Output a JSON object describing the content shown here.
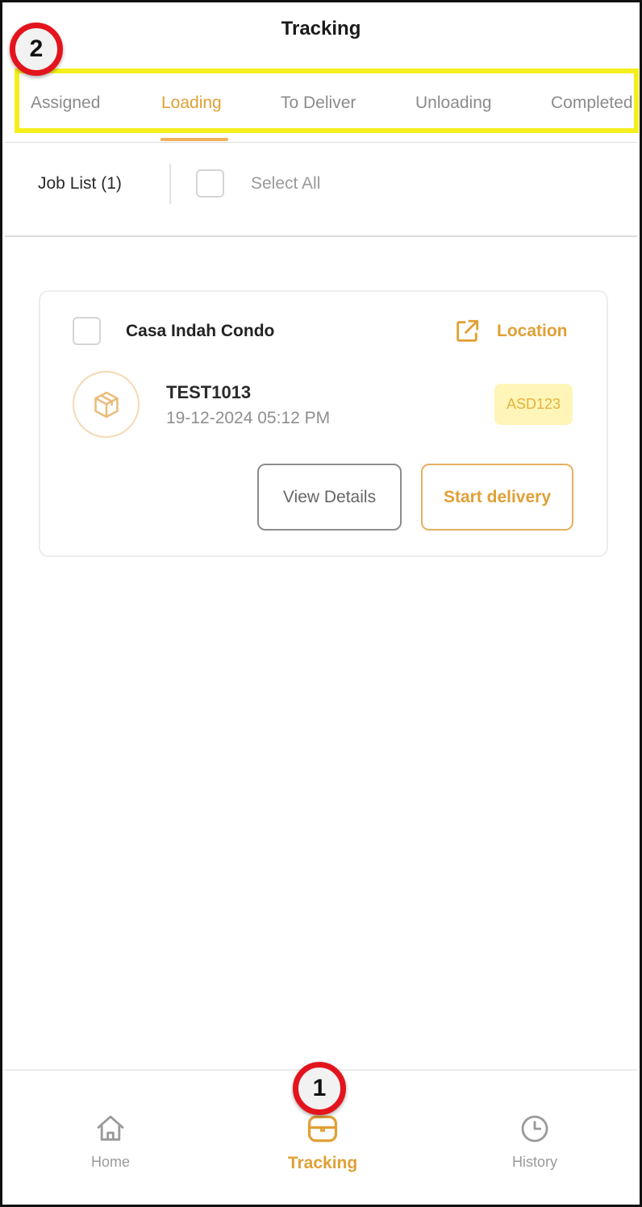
{
  "header": {
    "title": "Tracking"
  },
  "tabs": [
    {
      "label": "Assigned",
      "active": false
    },
    {
      "label": "Loading",
      "active": true
    },
    {
      "label": "To Deliver",
      "active": false
    },
    {
      "label": "Unloading",
      "active": false
    },
    {
      "label": "Completed",
      "active": false
    }
  ],
  "job_list": {
    "label": "Job List (1)",
    "select_all_label": "Select All",
    "select_all_checked": false
  },
  "jobs": [
    {
      "location_name": "Casa Indah Condo",
      "location_link_label": "Location",
      "job_id": "TEST1013",
      "datetime": "19-12-2024 05:12 PM",
      "badge": "ASD123",
      "checked": false,
      "view_details_label": "View Details",
      "start_delivery_label": "Start delivery"
    }
  ],
  "bottom_nav": [
    {
      "label": "Home",
      "icon": "home-icon",
      "active": false
    },
    {
      "label": "Tracking",
      "icon": "tracking-box-icon",
      "active": true
    },
    {
      "label": "History",
      "icon": "clock-icon",
      "active": false
    }
  ],
  "annotations": [
    {
      "label": "1"
    },
    {
      "label": "2"
    }
  ],
  "colors": {
    "accent": "#e0a035",
    "highlight_box": "#f4ef1c",
    "badge_bg": "#fff5b8",
    "marker_ring": "#e3141d"
  }
}
